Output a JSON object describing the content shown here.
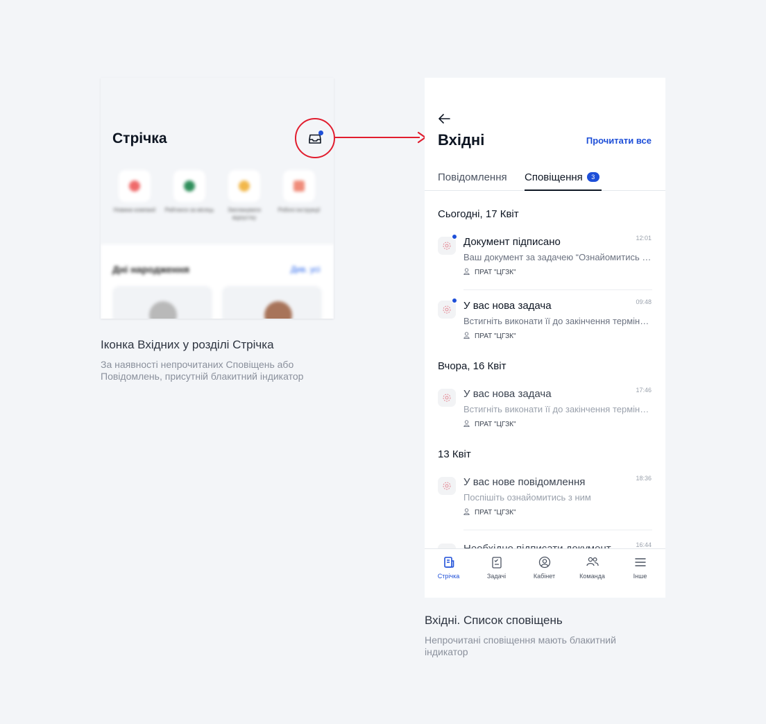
{
  "left_mockup": {
    "title": "Стрічка",
    "quick_actions": [
      "Новини компанії",
      "Рейтинги за місяць",
      "Запланувати відпустку",
      "Робочі інструкції"
    ],
    "birthdays_title": "Дні народження",
    "birthdays_link": "Див. усі"
  },
  "left_caption": {
    "title": "Іконка Вхідних у розділі Стрічка",
    "text_line1": "За наявності непрочитаних Сповіщень або",
    "text_line2": "Повідомлень, присутній блакитний індикатор"
  },
  "inbox": {
    "title": "Вхідні",
    "read_all": "Прочитати все",
    "tabs": [
      {
        "label": "Повідомлення",
        "active": false
      },
      {
        "label": "Сповіщення",
        "active": true,
        "badge": "3"
      }
    ],
    "groups": [
      {
        "date": "Сьогодні, 17 Квіт"
      },
      {
        "date": "Вчора, 16 Квіт"
      },
      {
        "date": "13 Квіт"
      }
    ],
    "notifications": [
      {
        "title": "Документ підписано",
        "time": "12:01",
        "text": "Ваш документ за задачею “Ознайомитись з документом”",
        "org": "ПРАТ \"ЦГЗК\"",
        "unread": true
      },
      {
        "title": "У вас нова задача",
        "time": "09:48",
        "text": "Встигніть виконати її до закінчення терміну виконання",
        "org": "ПРАТ \"ЦГЗК\"",
        "unread": true
      },
      {
        "title": "У вас нова задача",
        "time": "17:46",
        "text": "Встигніть виконати її до закінчення терміну виконання",
        "org": "ПРАТ \"ЦГЗК\"",
        "unread": false
      },
      {
        "title": "У вас нове повідомлення",
        "time": "18:36",
        "text": "Поспішіть ознайомитись з ним",
        "org": "ПРАТ \"ЦГЗК\"",
        "unread": false
      },
      {
        "title": "Необхідно підписати документ",
        "time": "16:44",
        "text": "",
        "org": "",
        "unread": false
      }
    ],
    "tabbar": [
      {
        "label": "Стрічка",
        "icon": "feed-icon",
        "active": true
      },
      {
        "label": "Задачі",
        "icon": "tasks-icon",
        "active": false
      },
      {
        "label": "Кабінет",
        "icon": "profile-icon",
        "active": false
      },
      {
        "label": "Команда",
        "icon": "team-icon",
        "active": false
      },
      {
        "label": "Інше",
        "icon": "menu-icon",
        "active": false
      }
    ]
  },
  "right_caption": {
    "title": "Вхідні. Список сповіщень",
    "text_line1": "Непрочитані сповіщення мають блакитний",
    "text_line2": "індикатор"
  },
  "colors": {
    "accent": "#1e4fd8",
    "highlight": "#e11d2e",
    "background": "#f3f5f8"
  }
}
